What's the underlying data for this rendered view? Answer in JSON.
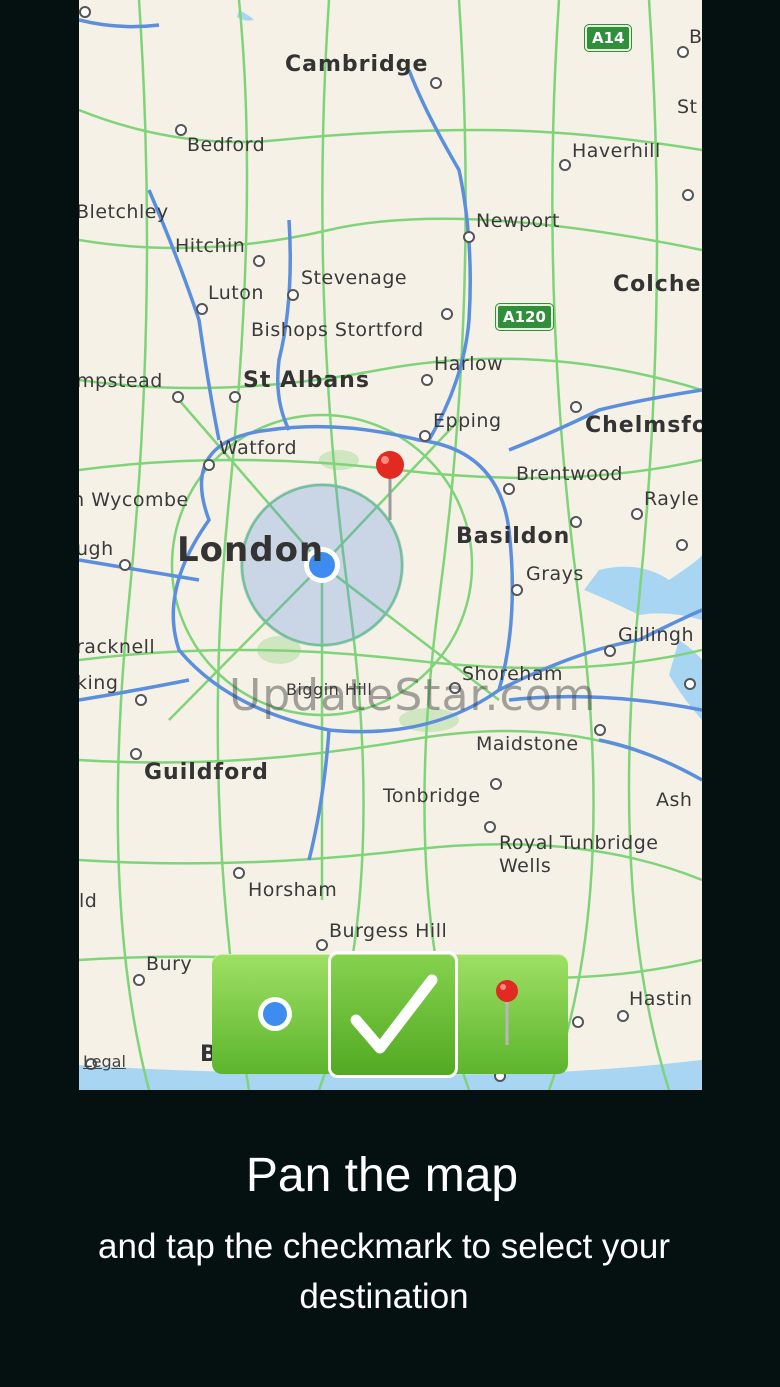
{
  "map": {
    "cities": [
      {
        "id": "cambridge",
        "label": "Cambridge"
      },
      {
        "id": "bedford",
        "label": "Bedford"
      },
      {
        "id": "haverhill",
        "label": "Haverhill"
      },
      {
        "id": "bletchley",
        "label": "Bletchley"
      },
      {
        "id": "newport",
        "label": "Newport"
      },
      {
        "id": "hitchin",
        "label": "Hitchin"
      },
      {
        "id": "stevenage",
        "label": "Stevenage"
      },
      {
        "id": "luton",
        "label": "Luton"
      },
      {
        "id": "colchester",
        "label": "Colche"
      },
      {
        "id": "bishops",
        "label": "Bishops Stortford"
      },
      {
        "id": "harlow",
        "label": "Harlow"
      },
      {
        "id": "hempstead",
        "label": "mpstead"
      },
      {
        "id": "stalbans",
        "label": "St Albans"
      },
      {
        "id": "epping",
        "label": "Epping"
      },
      {
        "id": "chelmsford",
        "label": "Chelmsfo"
      },
      {
        "id": "watford",
        "label": "Watford"
      },
      {
        "id": "brentwood",
        "label": "Brentwood"
      },
      {
        "id": "wycombe",
        "label": "High Wycombe"
      },
      {
        "id": "rayleigh",
        "label": "Rayle"
      },
      {
        "id": "london",
        "label": "London"
      },
      {
        "id": "basildon",
        "label": "Basildon"
      },
      {
        "id": "slough",
        "label": "ugh"
      },
      {
        "id": "grays",
        "label": "Grays"
      },
      {
        "id": "bracknell",
        "label": "racknell"
      },
      {
        "id": "gillingham",
        "label": "Gillingh"
      },
      {
        "id": "woking",
        "label": "king"
      },
      {
        "id": "shoreham",
        "label": "Shoreham"
      },
      {
        "id": "biggin",
        "label": "Biggin Hill"
      },
      {
        "id": "maidstone",
        "label": "Maidstone"
      },
      {
        "id": "guildford",
        "label": "Guildford"
      },
      {
        "id": "tonbridge",
        "label": "Tonbridge"
      },
      {
        "id": "ashford",
        "label": "Ash"
      },
      {
        "id": "tunbridge1",
        "label": "Royal Tunbridge"
      },
      {
        "id": "tunbridge2",
        "label": "Wells"
      },
      {
        "id": "horsham",
        "label": "Horsham"
      },
      {
        "id": "ld",
        "label": "ld"
      },
      {
        "id": "burgess",
        "label": "Burgess Hill"
      },
      {
        "id": "bury",
        "label": "Bury"
      },
      {
        "id": "hastings",
        "label": "Hastin"
      },
      {
        "id": "b",
        "label": "B"
      },
      {
        "id": "st",
        "label": "St"
      },
      {
        "id": "bb",
        "label": "B"
      }
    ],
    "shields": [
      "A14",
      "A120"
    ],
    "watermark": "UpdateStar.com",
    "legal": "Legal",
    "colors": {
      "land": "#f5f1e6",
      "green_road": "#7fd47a",
      "blue_road": "#5b8fde",
      "water": "#a8d5f2",
      "accent": "#5cb52c"
    }
  },
  "toolbar": {
    "buttons": [
      {
        "name": "current-location",
        "icon": "location-dot-icon"
      },
      {
        "name": "confirm",
        "icon": "checkmark-icon"
      },
      {
        "name": "destination",
        "icon": "red-pin-icon"
      }
    ]
  },
  "caption": {
    "headline": "Pan the map",
    "subline": "and tap the checkmark to select your destination"
  }
}
